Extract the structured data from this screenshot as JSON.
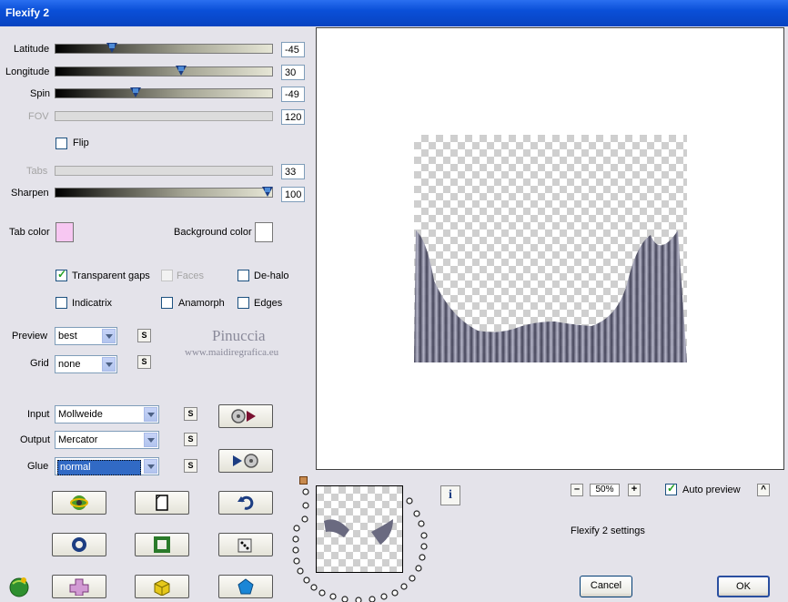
{
  "window": {
    "title": "Flexify 2"
  },
  "sliders": {
    "latitude": {
      "label": "Latitude",
      "value": "-45",
      "fraction": 0.26
    },
    "longitude": {
      "label": "Longitude",
      "value": "30",
      "fraction": 0.58
    },
    "spin": {
      "label": "Spin",
      "value": "-49",
      "fraction": 0.37
    },
    "fov": {
      "label": "FOV",
      "value": "120"
    },
    "tabs": {
      "label": "Tabs",
      "value": "33"
    },
    "sharpen": {
      "label": "Sharpen",
      "value": "100",
      "fraction": 0.98
    }
  },
  "flip": {
    "label": "Flip",
    "checked": false
  },
  "colors": {
    "tab_color_label": "Tab color",
    "tab_color": "#f7c7f2",
    "background_color_label": "Background color",
    "background_color": "#ffffff"
  },
  "options": {
    "transparent_gaps": {
      "label": "Transparent gaps",
      "checked": true
    },
    "faces": {
      "label": "Faces",
      "checked": false
    },
    "de_halo": {
      "label": "De-halo",
      "checked": false
    },
    "indicatrix": {
      "label": "Indicatrix",
      "checked": false
    },
    "anamorph": {
      "label": "Anamorph",
      "checked": false
    },
    "edges": {
      "label": "Edges",
      "checked": false
    }
  },
  "preview_select": {
    "label": "Preview",
    "value": "best"
  },
  "grid_select": {
    "label": "Grid",
    "value": "none"
  },
  "input_select": {
    "label": "Input",
    "value": "Mollweide"
  },
  "output_select": {
    "label": "Output",
    "value": "Mercator"
  },
  "glue_select": {
    "label": "Glue",
    "value": "normal"
  },
  "s_label": "S",
  "watermark": {
    "line1": "Pinuccia",
    "line2": "www.maidiregrafica.eu"
  },
  "zoom": {
    "minus": "–",
    "value": "50%",
    "plus": "+"
  },
  "auto_preview": {
    "label": "Auto preview",
    "checked": true
  },
  "settings_text": "Flexify 2 settings",
  "buttons": {
    "cancel": "Cancel",
    "ok": "OK",
    "caret": "^",
    "info": "i"
  },
  "accent": "#0a4fd8"
}
